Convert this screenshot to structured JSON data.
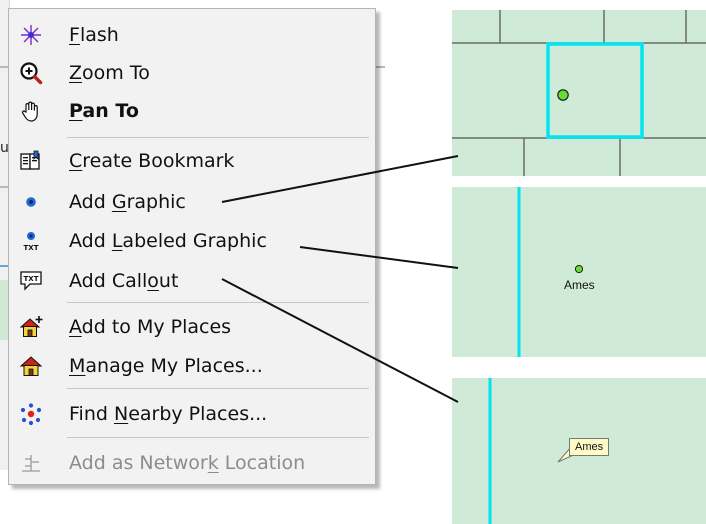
{
  "background": {
    "fragment_text": "u"
  },
  "menu": {
    "items": [
      {
        "id": "flash",
        "label": "Flash",
        "icon": "flash-icon",
        "underline": "F",
        "bold": false,
        "enabled": true
      },
      {
        "id": "zoom-to",
        "label": "Zoom To",
        "icon": "zoom-to-icon",
        "underline": "Z",
        "bold": false,
        "enabled": true
      },
      {
        "id": "pan-to",
        "label": "Pan To",
        "icon": "pan-hand-icon",
        "underline": "P",
        "bold": true,
        "enabled": true
      },
      {
        "id": "create-bookmark",
        "label": "Create Bookmark",
        "icon": "bookmark-icon",
        "underline": "C",
        "bold": false,
        "enabled": true
      },
      {
        "id": "add-graphic",
        "label": "Add Graphic",
        "icon": "graphic-point-icon",
        "underline": "G",
        "bold": false,
        "enabled": true
      },
      {
        "id": "add-labeled-graphic",
        "label": "Add Labeled Graphic",
        "icon": "labeled-graphic-icon",
        "underline": "L",
        "bold": false,
        "enabled": true
      },
      {
        "id": "add-callout",
        "label": "Add Callout",
        "icon": "callout-icon",
        "underline": "o",
        "bold": false,
        "enabled": true
      },
      {
        "id": "add-to-my-places",
        "label": "Add to My Places",
        "icon": "add-place-house-icon",
        "underline": "A",
        "bold": false,
        "enabled": true
      },
      {
        "id": "manage-my-places",
        "label": "Manage My Places...",
        "icon": "house-icon",
        "underline": "M",
        "bold": false,
        "enabled": true
      },
      {
        "id": "find-nearby-places",
        "label": "Find Nearby Places...",
        "icon": "nearby-dots-icon",
        "underline": "N",
        "bold": false,
        "enabled": true
      },
      {
        "id": "add-as-network-location",
        "label": "Add as Network Location",
        "icon": "network-location-icon",
        "underline": "k",
        "bold": false,
        "enabled": false
      }
    ]
  },
  "maps": {
    "labeled_graphic_label": "Ames",
    "callout_label": "Ames"
  },
  "colors": {
    "map_fill": "#cfead6",
    "selection_outline": "#00e5f0",
    "point_fill": "#66dd33",
    "callout_fill": "#fffbc8"
  }
}
